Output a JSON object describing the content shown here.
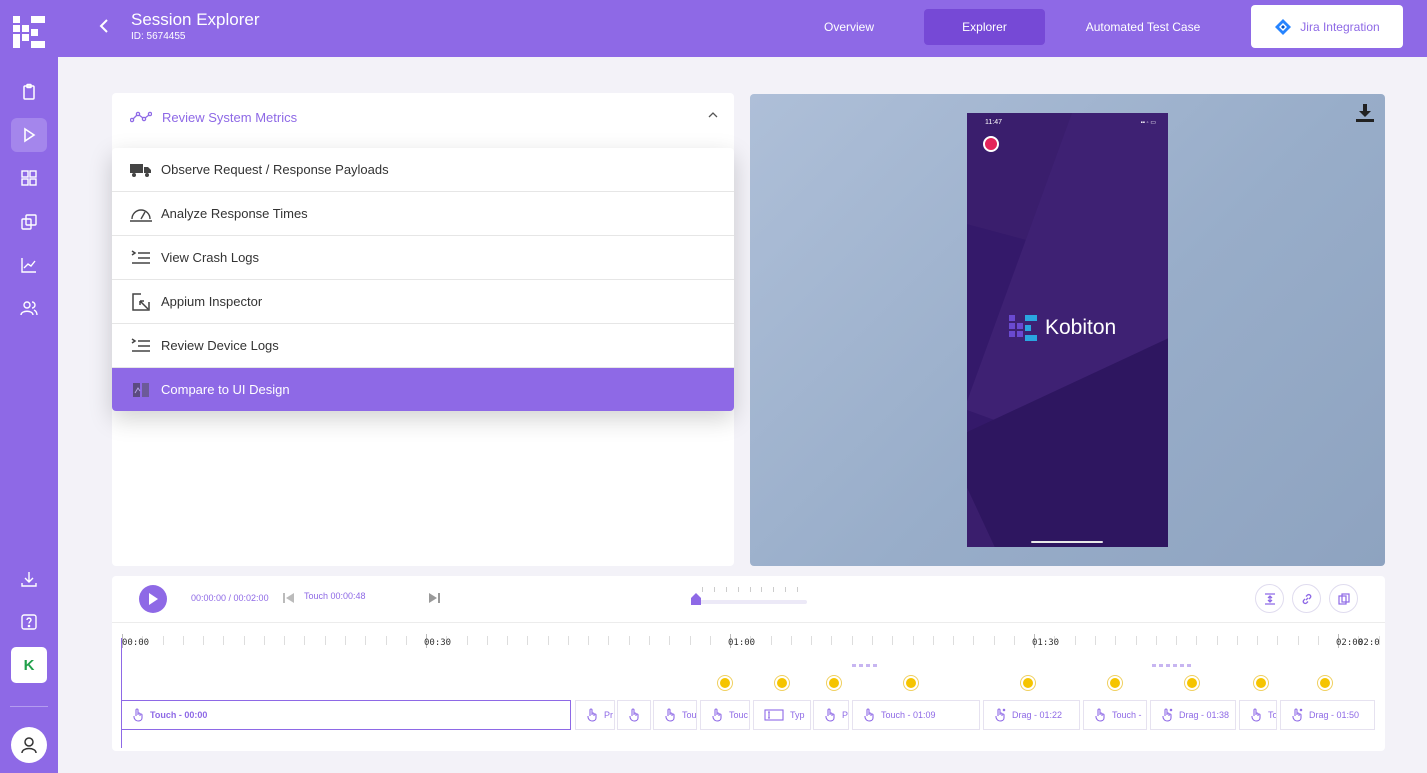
{
  "header": {
    "title": "Session Explorer",
    "session_id": "ID: 5674455",
    "tabs": [
      {
        "label": "Overview",
        "active": false
      },
      {
        "label": "Explorer",
        "active": true
      },
      {
        "label": "Automated Test Case",
        "active": false
      }
    ],
    "jira_label": "Jira Integration"
  },
  "sidebar": {
    "items": [
      "clipboard-icon",
      "play-icon",
      "grid-icon",
      "copy-icon",
      "chart-icon",
      "users-icon",
      "download-icon",
      "help-icon"
    ],
    "workspace_letter": "K"
  },
  "metrics": {
    "label": "Review System Metrics"
  },
  "menu": {
    "items": [
      {
        "label": "Observe Request / Response Payloads",
        "icon": "truck-icon"
      },
      {
        "label": "Analyze Response Times",
        "icon": "gauge-icon"
      },
      {
        "label": "View Crash Logs",
        "icon": "log-list-icon"
      },
      {
        "label": "Appium Inspector",
        "icon": "cursor-select-icon"
      },
      {
        "label": "Review Device Logs",
        "icon": "log-list-icon"
      },
      {
        "label": "Compare to UI Design",
        "icon": "compare-icon",
        "selected": true
      }
    ]
  },
  "device": {
    "status_time": "11:47",
    "app_name": "Kobiton"
  },
  "timeline": {
    "time": "00:00:00 / 00:02:00",
    "current_step": "Touch 00:00:48",
    "ruler": [
      "00:00",
      "00:30",
      "01:00",
      "01:30",
      "02:00",
      "02:0"
    ],
    "steps": [
      {
        "label": "Touch - 00:00",
        "icon": "touch"
      },
      {
        "label": "Pr",
        "icon": "touch"
      },
      {
        "label": "",
        "icon": "touch"
      },
      {
        "label": "Tou",
        "icon": "touch"
      },
      {
        "label": "Touc",
        "icon": "touch"
      },
      {
        "label": "Typ",
        "icon": "type"
      },
      {
        "label": "P",
        "icon": "touch"
      },
      {
        "label": "Touch - 01:09",
        "icon": "touch"
      },
      {
        "label": "Drag - 01:22",
        "icon": "drag"
      },
      {
        "label": "Touch -",
        "icon": "touch"
      },
      {
        "label": "Drag - 01:38",
        "icon": "drag"
      },
      {
        "label": "To",
        "icon": "touch"
      },
      {
        "label": "Drag - 01:50",
        "icon": "drag"
      }
    ]
  },
  "colors": {
    "brand": "#8e69e6",
    "brand_dark": "#7649d6",
    "marker": "#f5c400"
  }
}
